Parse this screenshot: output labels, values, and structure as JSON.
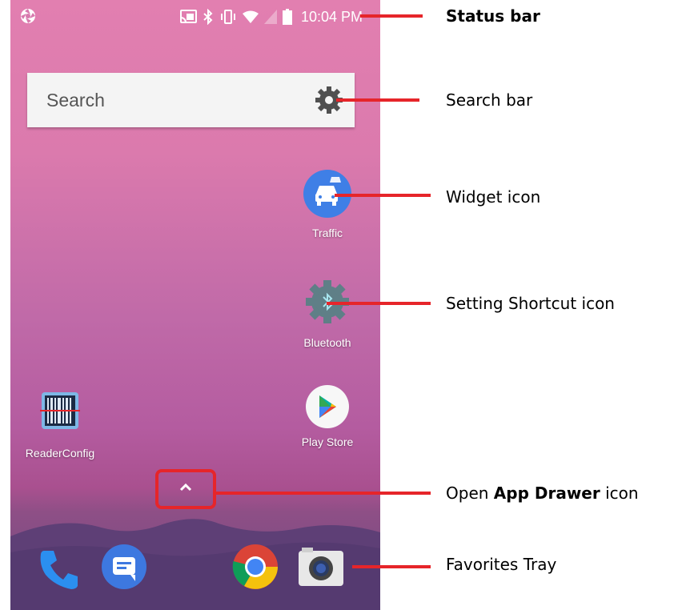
{
  "status_bar": {
    "time": "10:04 PM",
    "icons": [
      "camera-aperture-icon",
      "cast-icon",
      "bluetooth-icon",
      "vibrate-icon",
      "wifi-icon",
      "no-sim-icon",
      "battery-icon"
    ]
  },
  "search": {
    "placeholder": "Search",
    "settings_icon": "gear-icon"
  },
  "apps": {
    "traffic": {
      "label": "Traffic",
      "icon": "car-traffic-icon",
      "color": "#3f7fe6"
    },
    "bluetooth": {
      "label": "Bluetooth",
      "icon": "bluetooth-settings-gear-icon",
      "color": "#5f7f87"
    },
    "readerconfig": {
      "label": "ReaderConfig",
      "icon": "barcode-reader-icon"
    },
    "playstore": {
      "label": "Play Store",
      "icon": "play-store-icon"
    }
  },
  "app_drawer": {
    "icon": "chevron-up-icon"
  },
  "tray": {
    "items": [
      "phone-icon",
      "messages-icon",
      "chrome-icon",
      "camera-icon"
    ]
  },
  "annotations": {
    "status_bar": "Status bar",
    "search_bar": "Search bar",
    "widget_icon": "Widget icon",
    "setting_shortcut": "Setting Shortcut icon",
    "app_drawer_prefix": "Open ",
    "app_drawer_bold": "App Drawer",
    "app_drawer_suffix": " icon",
    "favorites_tray": "Favorites Tray"
  },
  "colors": {
    "annotation_line": "#e6252a",
    "accent_blue": "#3f7fe6"
  }
}
